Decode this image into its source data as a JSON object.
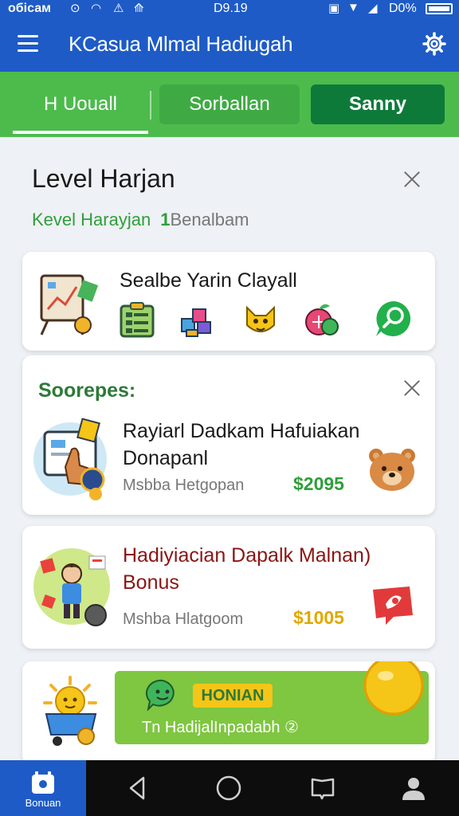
{
  "status_bar": {
    "carrier": "обісам",
    "time": "D9.19",
    "battery": "D0%"
  },
  "app_bar": {
    "title": "KCasua Mlmal Hadiugah"
  },
  "tabs": [
    {
      "label": "H Uouall"
    },
    {
      "label": "Sorballan"
    },
    {
      "label": "Sanny"
    }
  ],
  "level": {
    "title": "Level Harjan",
    "subtitle": "Kevel Harayjan",
    "count": "1",
    "extra": "Benalbam"
  },
  "skills": {
    "title": "Sealbe Yarin Clayall",
    "icons": [
      "chart-easel-icon",
      "checklist-icon",
      "blocks-icon",
      "fox-mascot-icon",
      "fruit-coin-icon",
      "search-chat-icon"
    ]
  },
  "deals_section": {
    "title": "Soorepes:"
  },
  "deals": [
    {
      "title_line1": "Rayiarl Dadkam Hafuiakan",
      "title_line2": "Donapanl",
      "meta": "Msbba Hetgopan",
      "price": "$2095",
      "icon": "bear-icon",
      "thumb": "tablet-hand-icon"
    },
    {
      "title_line1": "Hadiyiacian Dapalk Malnan)",
      "title_line2": "Bonus",
      "meta": "Mshba Hlatgoom",
      "price": "$1005",
      "icon": "red-gift-icon",
      "thumb": "boy-badges-icon"
    }
  ],
  "bonus": {
    "badge": "HONIAN",
    "text": "Tn HadijalInpadabh ②"
  },
  "nav": {
    "home_label": "Bonuan"
  },
  "colors": {
    "primary_blue": "#1e5bc6",
    "tab_green": "#4cbb4c",
    "active_green": "#0e7a3a",
    "price_green": "#2f9e3a",
    "price_gold": "#e0a800"
  }
}
